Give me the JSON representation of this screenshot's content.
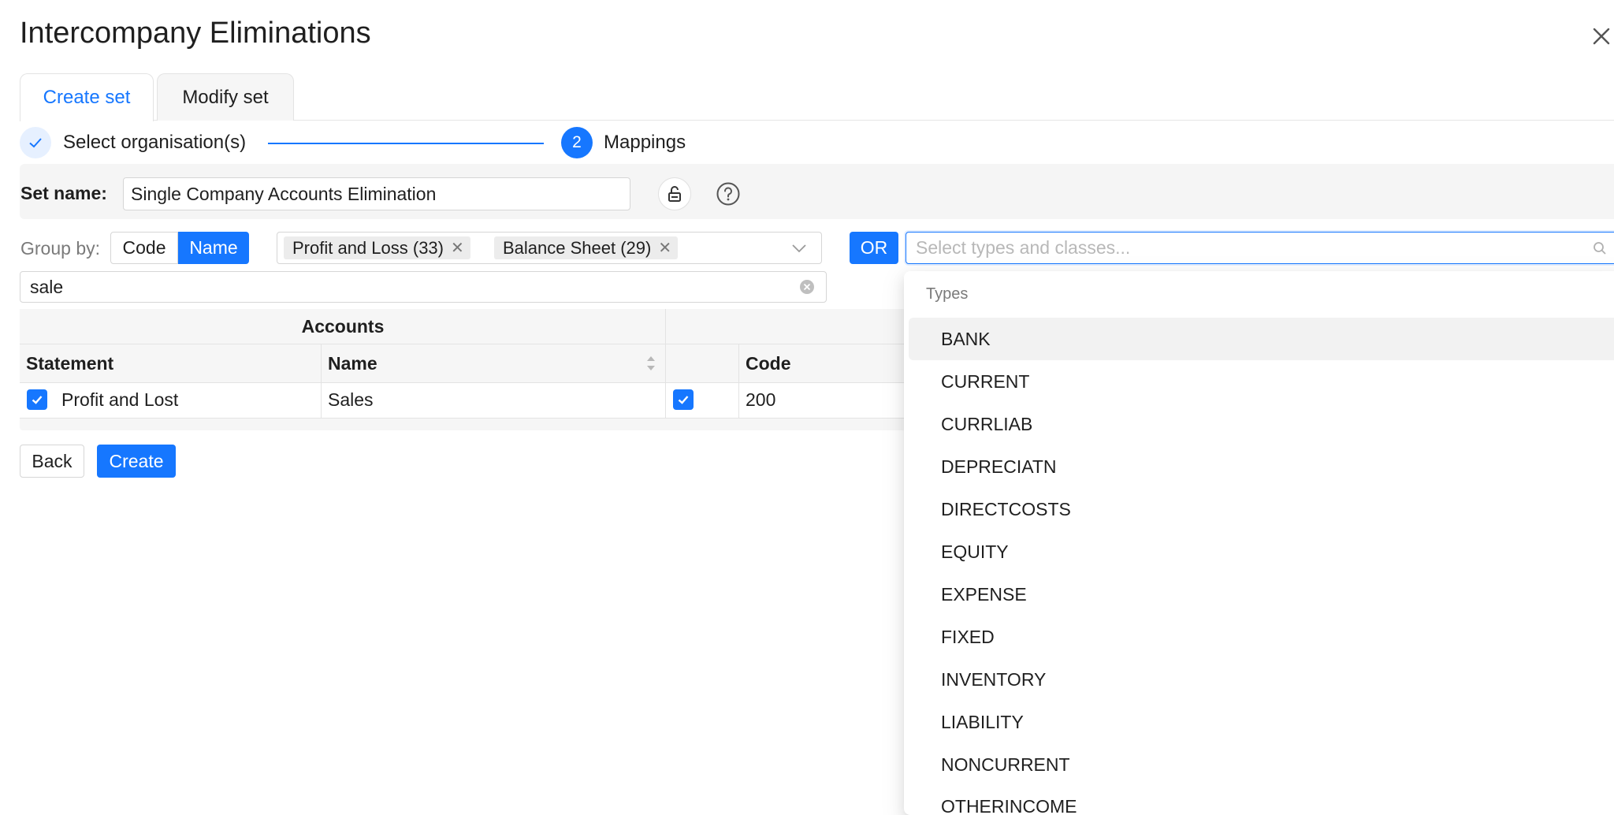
{
  "dialog": {
    "title": "Intercompany Eliminations"
  },
  "tabs": [
    {
      "label": "Create set",
      "active": true
    },
    {
      "label": "Modify set",
      "active": false
    }
  ],
  "steps": [
    {
      "label": "Select organisation(s)",
      "status": "done"
    },
    {
      "number": "2",
      "label": "Mappings",
      "status": "current"
    }
  ],
  "set_name": {
    "label": "Set name:",
    "value": "Single Company Accounts Elimination"
  },
  "group_by": {
    "label": "Group by:",
    "options": [
      "Code",
      "Name"
    ],
    "selected": "Name"
  },
  "statement_filter": {
    "tags": [
      "Profit and Loss (33)",
      "Balance Sheet (29)"
    ]
  },
  "or_button": "OR",
  "type_search": {
    "placeholder": "Select types and classes..."
  },
  "account_filter": {
    "value": "sale"
  },
  "table": {
    "group_header": "Accounts",
    "columns": [
      "Statement",
      "Name",
      "Code"
    ],
    "rows": [
      {
        "statement": "Profit and Lost",
        "name": "Sales",
        "code": "200",
        "checked": true,
        "row_checked": true
      }
    ]
  },
  "buttons": {
    "back": "Back",
    "create": "Create"
  },
  "dropdown": {
    "group_label": "Types",
    "items": [
      "BANK",
      "CURRENT",
      "CURRLIAB",
      "DEPRECIATN",
      "DIRECTCOSTS",
      "EQUITY",
      "EXPENSE",
      "FIXED",
      "INVENTORY",
      "LIABILITY",
      "NONCURRENT",
      "OTHERINCOME"
    ],
    "highlighted": "BANK"
  },
  "colors": {
    "accent": "#1677ff",
    "text": "#1f1f1f",
    "muted": "#7a7a7a",
    "border": "#d6d6d6"
  },
  "icons": [
    "close-icon",
    "check-icon",
    "unlock-icon",
    "help-icon",
    "chevron-down-icon",
    "search-icon",
    "clear-icon",
    "sort-icon"
  ]
}
